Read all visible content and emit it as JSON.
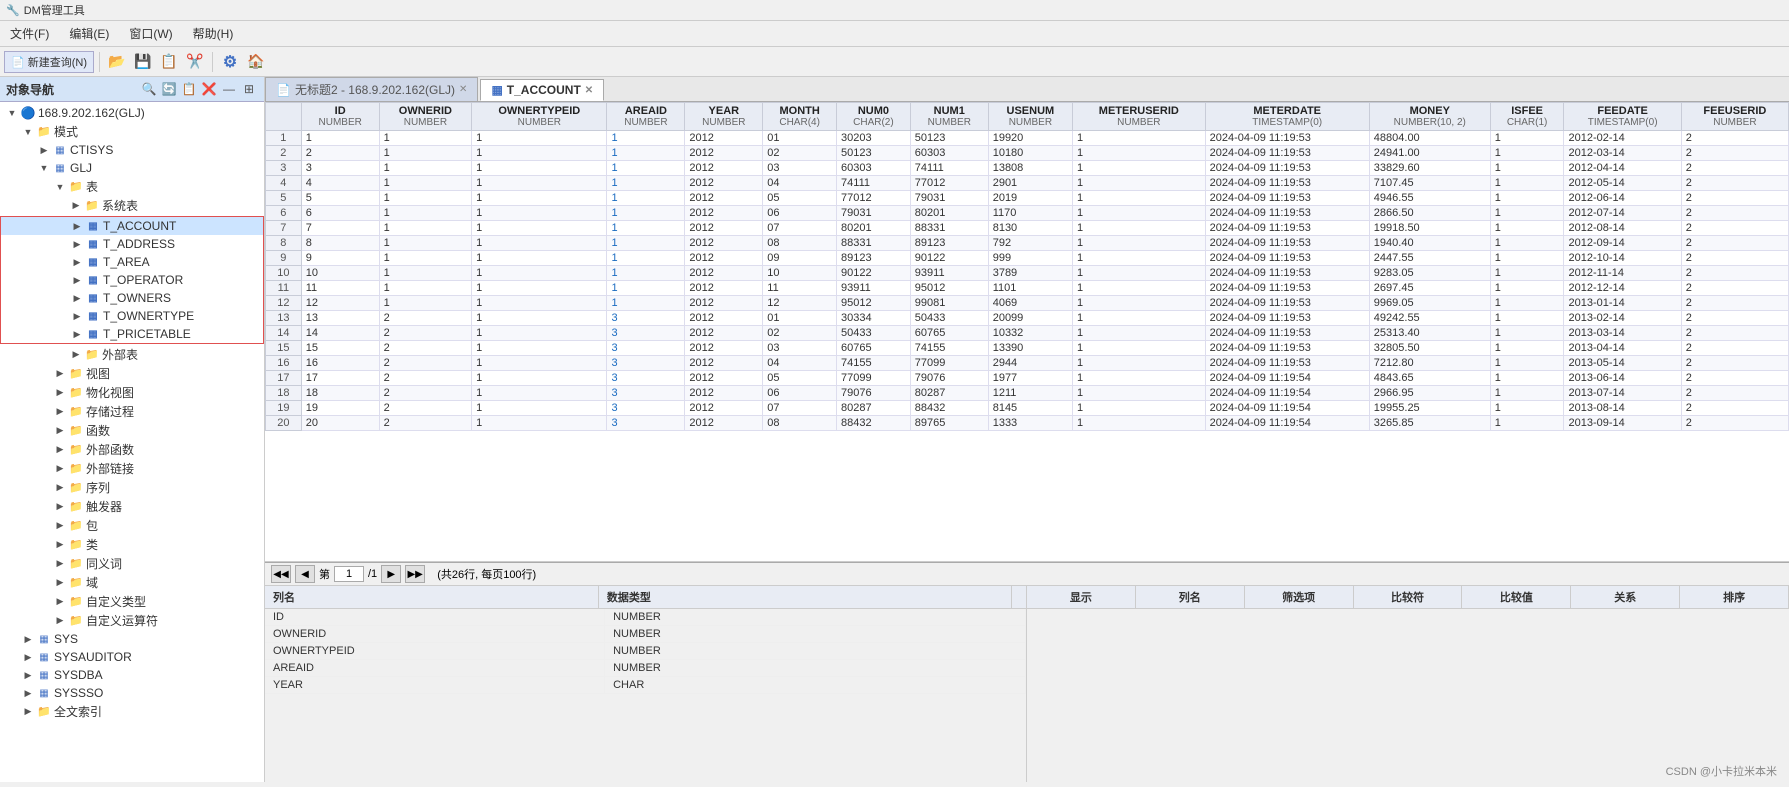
{
  "app": {
    "title": "DM管理工具",
    "menus": [
      "文件(F)",
      "编辑(E)",
      "窗口(W)",
      "帮助(H)"
    ],
    "toolbar_new_query": "新建查询(N)"
  },
  "left_panel": {
    "title": "对象导航",
    "root": "168.9.202.162(GLJ)",
    "tree": [
      {
        "label": "模式",
        "level": 1,
        "expanded": true
      },
      {
        "label": "CTISYS",
        "level": 2
      },
      {
        "label": "GLJ",
        "level": 2,
        "expanded": true
      },
      {
        "label": "表",
        "level": 3,
        "expanded": true
      },
      {
        "label": "系统表",
        "level": 4
      },
      {
        "label": "T_ACCOUNT",
        "level": 4,
        "highlighted": true
      },
      {
        "label": "T_ADDRESS",
        "level": 4,
        "highlighted": true
      },
      {
        "label": "T_AREA",
        "level": 4,
        "highlighted": true
      },
      {
        "label": "T_OPERATOR",
        "level": 4,
        "highlighted": true
      },
      {
        "label": "T_OWNERS",
        "level": 4,
        "highlighted": true
      },
      {
        "label": "T_OWNERTYPE",
        "level": 4,
        "highlighted": true
      },
      {
        "label": "T_PRICETABLE",
        "level": 4,
        "highlighted": true
      },
      {
        "label": "外部表",
        "level": 4
      },
      {
        "label": "视图",
        "level": 3
      },
      {
        "label": "物化视图",
        "level": 3
      },
      {
        "label": "存储过程",
        "level": 3
      },
      {
        "label": "函数",
        "level": 3
      },
      {
        "label": "外部函数",
        "level": 3
      },
      {
        "label": "外部链接",
        "level": 3
      },
      {
        "label": "序列",
        "level": 3
      },
      {
        "label": "触发器",
        "level": 3
      },
      {
        "label": "包",
        "level": 3
      },
      {
        "label": "类",
        "level": 3
      },
      {
        "label": "同义词",
        "level": 3
      },
      {
        "label": "域",
        "level": 3
      },
      {
        "label": "自定义类型",
        "level": 3
      },
      {
        "label": "自定义运算符",
        "level": 3
      },
      {
        "label": "SYS",
        "level": 1
      },
      {
        "label": "SYSAUDITOR",
        "level": 1
      },
      {
        "label": "SYSDBA",
        "level": 1
      },
      {
        "label": "SYSSSO",
        "level": 1
      },
      {
        "label": "全文索引",
        "level": 1
      }
    ]
  },
  "tabs": [
    {
      "label": "无标题2 - 168.9.202.162(GLJ)",
      "active": false,
      "closable": true
    },
    {
      "label": "T_ACCOUNT",
      "active": true,
      "closable": true
    }
  ],
  "table": {
    "columns": [
      {
        "name": "ID",
        "type": "NUMBER"
      },
      {
        "name": "OWNERID",
        "type": "NUMBER"
      },
      {
        "name": "OWNERTYPEID",
        "type": "NUMBER"
      },
      {
        "name": "AREAID",
        "type": "NUMBER"
      },
      {
        "name": "YEAR",
        "type": "NUMBER"
      },
      {
        "name": "MONTH",
        "type": "CHAR(4)"
      },
      {
        "name": "NUM0",
        "type": "CHAR(2)"
      },
      {
        "name": "NUM1",
        "type": "NUMBER"
      },
      {
        "name": "USENUM",
        "type": "NUMBER"
      },
      {
        "name": "METERUSERID",
        "type": "NUMBER"
      },
      {
        "name": "METERDATE",
        "type": "TIMESTAMP(0)"
      },
      {
        "name": "MONEY",
        "type": "NUMBER(10, 2)"
      },
      {
        "name": "ISFEE",
        "type": "CHAR(1)"
      },
      {
        "name": "FEEDATE",
        "type": "TIMESTAMP(0)"
      },
      {
        "name": "FEEUSERID",
        "type": "NUMBER"
      }
    ],
    "rows": [
      [
        1,
        1,
        1,
        1,
        2012,
        "01",
        30203,
        50123,
        19920,
        1,
        "2024-04-09 11:19:53",
        "48804.00",
        1,
        "2012-02-14",
        2
      ],
      [
        2,
        1,
        1,
        1,
        2012,
        "02",
        50123,
        60303,
        10180,
        1,
        "2024-04-09 11:19:53",
        "24941.00",
        1,
        "2012-03-14",
        2
      ],
      [
        3,
        1,
        1,
        1,
        2012,
        "03",
        60303,
        74111,
        13808,
        1,
        "2024-04-09 11:19:53",
        "33829.60",
        1,
        "2012-04-14",
        2
      ],
      [
        4,
        1,
        1,
        1,
        2012,
        "04",
        74111,
        77012,
        2901,
        1,
        "2024-04-09 11:19:53",
        "7107.45",
        1,
        "2012-05-14",
        2
      ],
      [
        5,
        1,
        1,
        1,
        2012,
        "05",
        77012,
        79031,
        2019,
        1,
        "2024-04-09 11:19:53",
        "4946.55",
        1,
        "2012-06-14",
        2
      ],
      [
        6,
        1,
        1,
        1,
        2012,
        "06",
        79031,
        80201,
        1170,
        1,
        "2024-04-09 11:19:53",
        "2866.50",
        1,
        "2012-07-14",
        2
      ],
      [
        7,
        1,
        1,
        1,
        2012,
        "07",
        80201,
        88331,
        8130,
        1,
        "2024-04-09 11:19:53",
        "19918.50",
        1,
        "2012-08-14",
        2
      ],
      [
        8,
        1,
        1,
        1,
        2012,
        "08",
        88331,
        89123,
        792,
        1,
        "2024-04-09 11:19:53",
        "1940.40",
        1,
        "2012-09-14",
        2
      ],
      [
        9,
        1,
        1,
        1,
        2012,
        "09",
        89123,
        90122,
        999,
        1,
        "2024-04-09 11:19:53",
        "2447.55",
        1,
        "2012-10-14",
        2
      ],
      [
        10,
        1,
        1,
        1,
        2012,
        "10",
        90122,
        93911,
        3789,
        1,
        "2024-04-09 11:19:53",
        "9283.05",
        1,
        "2012-11-14",
        2
      ],
      [
        11,
        1,
        1,
        1,
        2012,
        "11",
        93911,
        95012,
        1101,
        1,
        "2024-04-09 11:19:53",
        "2697.45",
        1,
        "2012-12-14",
        2
      ],
      [
        12,
        1,
        1,
        1,
        2012,
        "12",
        95012,
        99081,
        4069,
        1,
        "2024-04-09 11:19:53",
        "9969.05",
        1,
        "2013-01-14",
        2
      ],
      [
        13,
        2,
        1,
        3,
        2012,
        "01",
        30334,
        50433,
        20099,
        1,
        "2024-04-09 11:19:53",
        "49242.55",
        1,
        "2013-02-14",
        2
      ],
      [
        14,
        2,
        1,
        3,
        2012,
        "02",
        50433,
        60765,
        10332,
        1,
        "2024-04-09 11:19:53",
        "25313.40",
        1,
        "2013-03-14",
        2
      ],
      [
        15,
        2,
        1,
        3,
        2012,
        "03",
        60765,
        74155,
        13390,
        1,
        "2024-04-09 11:19:53",
        "32805.50",
        1,
        "2013-04-14",
        2
      ],
      [
        16,
        2,
        1,
        3,
        2012,
        "04",
        74155,
        77099,
        2944,
        1,
        "2024-04-09 11:19:53",
        "7212.80",
        1,
        "2013-05-14",
        2
      ],
      [
        17,
        2,
        1,
        3,
        2012,
        "05",
        77099,
        79076,
        1977,
        1,
        "2024-04-09 11:19:54",
        "4843.65",
        1,
        "2013-06-14",
        2
      ],
      [
        18,
        2,
        1,
        3,
        2012,
        "06",
        79076,
        80287,
        1211,
        1,
        "2024-04-09 11:19:54",
        "2966.95",
        1,
        "2013-07-14",
        2
      ],
      [
        19,
        2,
        1,
        3,
        2012,
        "07",
        80287,
        88432,
        8145,
        1,
        "2024-04-09 11:19:54",
        "19955.25",
        1,
        "2013-08-14",
        2
      ],
      [
        20,
        2,
        1,
        3,
        2012,
        "08",
        88432,
        89765,
        1333,
        1,
        "2024-04-09 11:19:54",
        "3265.85",
        1,
        "2013-09-14",
        2
      ]
    ]
  },
  "pagination": {
    "first": "◀◀",
    "prev": "◀",
    "next": "▶",
    "last": "▶▶",
    "current_page": "1",
    "total_pages": "1",
    "summary": "(共26行, 每页100行)"
  },
  "bottom_left": {
    "headers": [
      "列名",
      "数据类型"
    ],
    "rows": [
      [
        "ID",
        "NUMBER"
      ],
      [
        "OWNERID",
        "NUMBER"
      ],
      [
        "OWNERTYPEID",
        "NUMBER"
      ],
      [
        "AREAID",
        "NUMBER"
      ],
      [
        "YEAR",
        "CHAR"
      ]
    ]
  },
  "bottom_right": {
    "headers": [
      "显示",
      "列名",
      "筛选项",
      "比较符",
      "比较值",
      "关系",
      "排序"
    ]
  },
  "watermark": "CSDN @小卡拉米本米"
}
